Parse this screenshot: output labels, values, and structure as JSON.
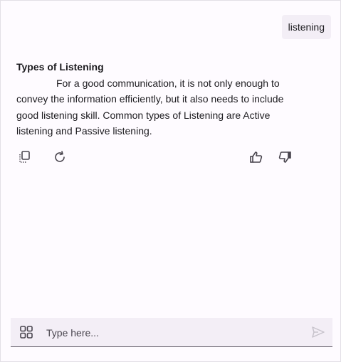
{
  "conversation": {
    "user_message": "listening",
    "response": {
      "title": "Types of Listening",
      "body": "For a good communication, it is not only enough to convey the information efficiently, but it also needs to include good listening skill. Common types of Listening are Active listening and Passive listening."
    },
    "actions": [
      {
        "name": "copy-icon"
      },
      {
        "name": "regenerate-icon"
      },
      {
        "name": "thumbs-up-icon"
      },
      {
        "name": "thumbs-down-icon"
      }
    ]
  },
  "composer": {
    "placeholder": "Type here...",
    "value": "",
    "menu_icon": "grid-icon",
    "send_icon": "send-icon"
  },
  "colors": {
    "background": "#fefbff",
    "bubble": "#f3eef6",
    "text": "#1c1b1f",
    "icon": "#49454e",
    "send_disabled": "#c7c3cc"
  }
}
